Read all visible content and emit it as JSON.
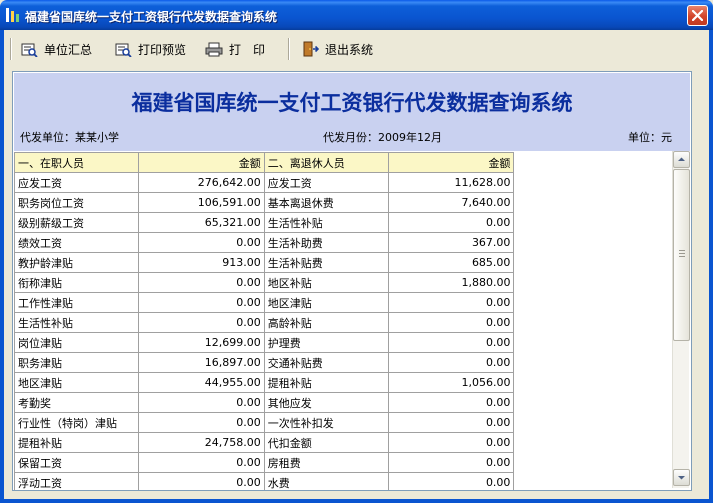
{
  "window": {
    "title": "福建省国库统一支付工资银行代发数据查询系统"
  },
  "toolbar": {
    "summary_label": "单位汇总",
    "preview_label": "打印预览",
    "print_label": "打　印",
    "exit_label": "退出系统"
  },
  "report": {
    "title": "福建省国库统一支付工资银行代发数据查询系统",
    "unit_label": "代发单位：某某小学",
    "month_label": "代发月份：2009年12月",
    "currency_label": "单位：元"
  },
  "table": {
    "header": {
      "left_label": "一、在职人员",
      "left_amount": "金额",
      "right_label": "二、离退休人员",
      "right_amount": "金额"
    },
    "rows": [
      {
        "left_label": "应发工资",
        "left_amount": "276,642.00",
        "right_label": "应发工资",
        "right_amount": "11,628.00"
      },
      {
        "left_label": "职务岗位工资",
        "left_amount": "106,591.00",
        "right_label": "基本离退休费",
        "right_amount": "7,640.00"
      },
      {
        "left_label": "级别薪级工资",
        "left_amount": "65,321.00",
        "right_label": "生活性补贴",
        "right_amount": "0.00"
      },
      {
        "left_label": "绩效工资",
        "left_amount": "0.00",
        "right_label": "生活补助费",
        "right_amount": "367.00"
      },
      {
        "left_label": "教护龄津贴",
        "left_amount": "913.00",
        "right_label": "生活补贴费",
        "right_amount": "685.00"
      },
      {
        "left_label": "衔称津贴",
        "left_amount": "0.00",
        "right_label": "地区补贴",
        "right_amount": "1,880.00"
      },
      {
        "left_label": "工作性津贴",
        "left_amount": "0.00",
        "right_label": "地区津贴",
        "right_amount": "0.00"
      },
      {
        "left_label": "生活性补贴",
        "left_amount": "0.00",
        "right_label": "高龄补贴",
        "right_amount": "0.00"
      },
      {
        "left_label": "岗位津贴",
        "left_amount": "12,699.00",
        "right_label": "护理费",
        "right_amount": "0.00"
      },
      {
        "left_label": "职务津贴",
        "left_amount": "16,897.00",
        "right_label": "交通补贴费",
        "right_amount": "0.00"
      },
      {
        "left_label": "地区津贴",
        "left_amount": "44,955.00",
        "right_label": "提租补贴",
        "right_amount": "1,056.00"
      },
      {
        "left_label": "考勤奖",
        "left_amount": "0.00",
        "right_label": "其他应发",
        "right_amount": "0.00"
      },
      {
        "left_label": "行业性（特岗）津贴",
        "left_amount": "0.00",
        "right_label": "一次性补扣发",
        "right_amount": "0.00"
      },
      {
        "left_label": "提租补贴",
        "left_amount": "24,758.00",
        "right_label": "代扣金额",
        "right_amount": "0.00"
      },
      {
        "left_label": "保留工资",
        "left_amount": "0.00",
        "right_label": "房租费",
        "right_amount": "0.00"
      },
      {
        "left_label": "浮动工资",
        "left_amount": "0.00",
        "right_label": "水费",
        "right_amount": "0.00"
      }
    ]
  },
  "icons": {
    "summary": "report-icon",
    "preview": "preview-icon",
    "print": "printer-icon",
    "exit": "exit-door-icon",
    "close": "close-icon"
  },
  "colors": {
    "title_blue": "#0b2e9e",
    "header_band": "#c9d1f0",
    "header_row": "#fbf7c6",
    "titlebar": "#0a55d0"
  }
}
